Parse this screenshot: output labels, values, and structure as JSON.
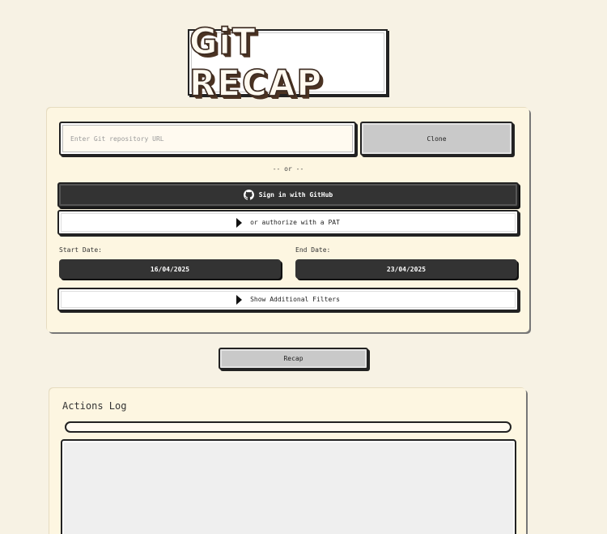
{
  "header": {
    "title": "GiT RECAP"
  },
  "repo": {
    "input_value": "",
    "input_placeholder": "Enter Git repository URL",
    "clone_label": "Clone"
  },
  "auth": {
    "separator": "-- or --",
    "github_label": "Sign in with GitHub",
    "github_icon": "github-icon",
    "pat_label": "or authorize with a PAT",
    "pat_expanded": false
  },
  "dates": {
    "start_label": "Start Date:",
    "start_value": "16/04/2025",
    "end_label": "End Date:",
    "end_value": "23/04/2025"
  },
  "filters": {
    "toggle_label": "Show Additional Filters",
    "expanded": false
  },
  "actions": {
    "recap_label": "Recap"
  },
  "log": {
    "title": "Actions Log",
    "progress": 0,
    "content": ""
  },
  "colors": {
    "background": "#f7f2e4",
    "panel": "#fdf6e1",
    "dark_button": "#333333",
    "grey_button": "#c9c9c9"
  }
}
